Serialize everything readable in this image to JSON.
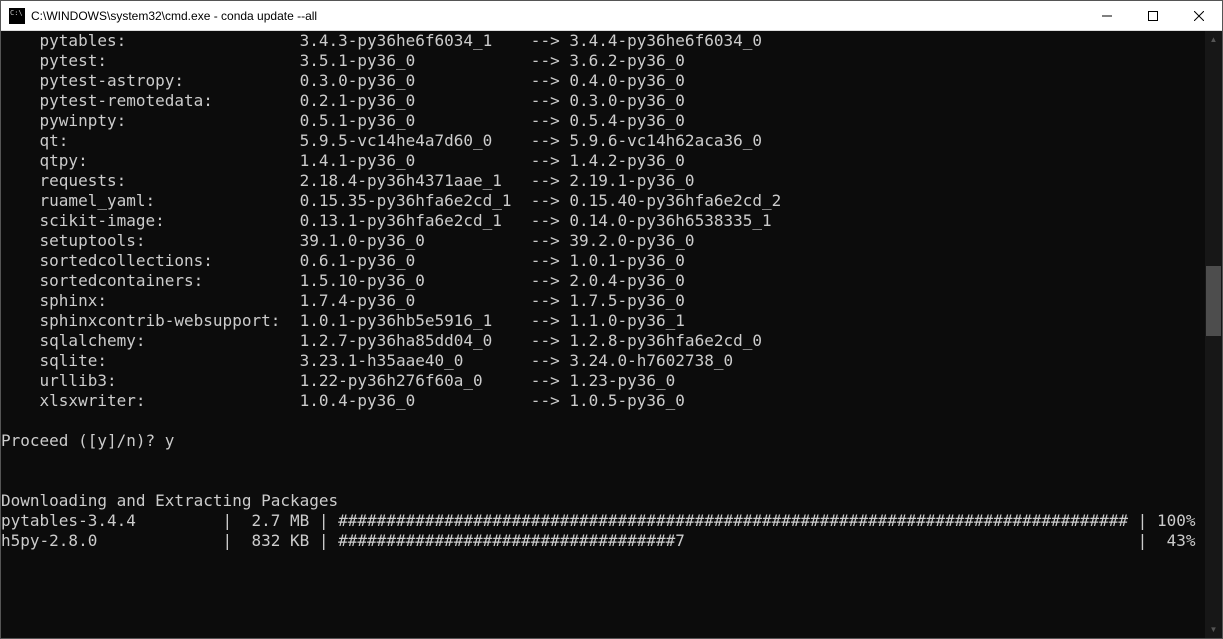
{
  "window": {
    "title": "C:\\WINDOWS\\system32\\cmd.exe - conda  update --all"
  },
  "packages": [
    {
      "name": "pytables",
      "from": "3.4.3-py36he6f6034_1",
      "to": "3.4.4-py36he6f6034_0"
    },
    {
      "name": "pytest",
      "from": "3.5.1-py36_0",
      "to": "3.6.2-py36_0"
    },
    {
      "name": "pytest-astropy",
      "from": "0.3.0-py36_0",
      "to": "0.4.0-py36_0"
    },
    {
      "name": "pytest-remotedata",
      "from": "0.2.1-py36_0",
      "to": "0.3.0-py36_0"
    },
    {
      "name": "pywinpty",
      "from": "0.5.1-py36_0",
      "to": "0.5.4-py36_0"
    },
    {
      "name": "qt",
      "from": "5.9.5-vc14he4a7d60_0",
      "to": "5.9.6-vc14h62aca36_0"
    },
    {
      "name": "qtpy",
      "from": "1.4.1-py36_0",
      "to": "1.4.2-py36_0"
    },
    {
      "name": "requests",
      "from": "2.18.4-py36h4371aae_1",
      "to": "2.19.1-py36_0"
    },
    {
      "name": "ruamel_yaml",
      "from": "0.15.35-py36hfa6e2cd_1",
      "to": "0.15.40-py36hfa6e2cd_2"
    },
    {
      "name": "scikit-image",
      "from": "0.13.1-py36hfa6e2cd_1",
      "to": "0.14.0-py36h6538335_1"
    },
    {
      "name": "setuptools",
      "from": "39.1.0-py36_0",
      "to": "39.2.0-py36_0"
    },
    {
      "name": "sortedcollections",
      "from": "0.6.1-py36_0",
      "to": "1.0.1-py36_0"
    },
    {
      "name": "sortedcontainers",
      "from": "1.5.10-py36_0",
      "to": "2.0.4-py36_0"
    },
    {
      "name": "sphinx",
      "from": "1.7.4-py36_0",
      "to": "1.7.5-py36_0"
    },
    {
      "name": "sphinxcontrib-websupport",
      "from": "1.0.1-py36hb5e5916_1",
      "to": "1.1.0-py36_1"
    },
    {
      "name": "sqlalchemy",
      "from": "1.2.7-py36ha85dd04_0",
      "to": "1.2.8-py36hfa6e2cd_0"
    },
    {
      "name": "sqlite",
      "from": "3.23.1-h35aae40_0",
      "to": "3.24.0-h7602738_0"
    },
    {
      "name": "urllib3",
      "from": "1.22-py36h276f60a_0",
      "to": "1.23-py36_0"
    },
    {
      "name": "xlsxwriter",
      "from": "1.0.4-py36_0",
      "to": "1.0.5-py36_0"
    }
  ],
  "prompt": {
    "text": "Proceed ([y]/n)? ",
    "answer": "y"
  },
  "section_header": "Downloading and Extracting Packages",
  "downloads": [
    {
      "name": "pytables-3.4.4",
      "size": "2.7 MB",
      "bar": "##################################################################################",
      "pct": "100%"
    },
    {
      "name": "h5py-2.8.0",
      "size": "832 KB",
      "bar": "###################################7",
      "pct": "43%"
    }
  ]
}
